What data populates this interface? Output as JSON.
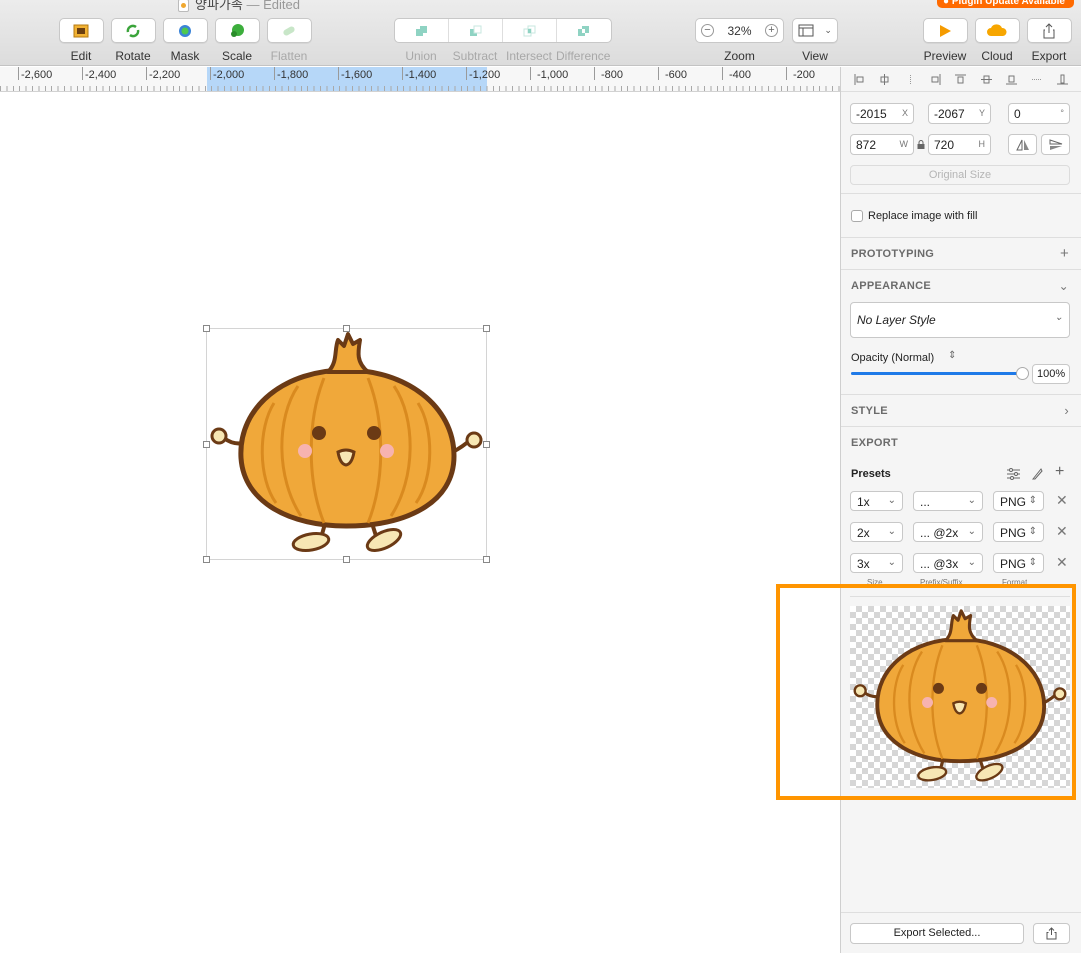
{
  "window": {
    "doc_title": "양파가족",
    "doc_status": "— Edited",
    "plugin_badge": "● Plugin Update Available"
  },
  "toolbar": {
    "edit": "Edit",
    "rotate": "Rotate",
    "mask": "Mask",
    "scale": "Scale",
    "flatten": "Flatten",
    "union": "Union",
    "subtract": "Subtract",
    "intersect": "Intersect",
    "difference": "Difference",
    "zoom_value": "32%",
    "zoom_label": "Zoom",
    "view_label": "View",
    "preview": "Preview",
    "cloud": "Cloud",
    "export": "Export"
  },
  "ruler": {
    "labels": [
      "-2,600",
      "-2,400",
      "-2,200",
      "-2,000",
      "-1,800",
      "-1,600",
      "-1,400",
      "-1,200",
      "-1,000",
      "-800",
      "-600",
      "-400",
      "-200"
    ]
  },
  "inspector": {
    "x_value": "-2015",
    "x_suffix": "X",
    "y_value": "-2067",
    "y_suffix": "Y",
    "rotation_value": "0",
    "rotation_suffix": "°",
    "w_value": "872",
    "w_suffix": "W",
    "h_value": "720",
    "h_suffix": "H",
    "original_size": "Original Size",
    "replace_fill_label": "Replace image with fill",
    "prototyping": "PROTOTYPING",
    "appearance": "APPEARANCE",
    "layer_style": "No Layer Style",
    "opacity_label": "Opacity (Normal)",
    "opacity_value": "100%",
    "opacity_fraction": 1.0,
    "style": "STYLE",
    "export_header": "EXPORT",
    "presets_label": "Presets",
    "presets": [
      {
        "size": "1x",
        "suffix": "...",
        "format": "PNG"
      },
      {
        "size": "2x",
        "suffix": "... @2x",
        "format": "PNG"
      },
      {
        "size": "3x",
        "suffix": "... @3x",
        "format": "PNG"
      }
    ],
    "col_size": "Size",
    "col_suffix": "Prefix/Suffix",
    "col_format": "Format",
    "export_selected": "Export Selected..."
  },
  "colors": {
    "highlight": "#ff9500",
    "onion_fill": "#f0a83a",
    "onion_stroke": "#6b3a15",
    "ruler_selection": "#b6d7f8",
    "slider_blue": "#1f7ae8"
  }
}
